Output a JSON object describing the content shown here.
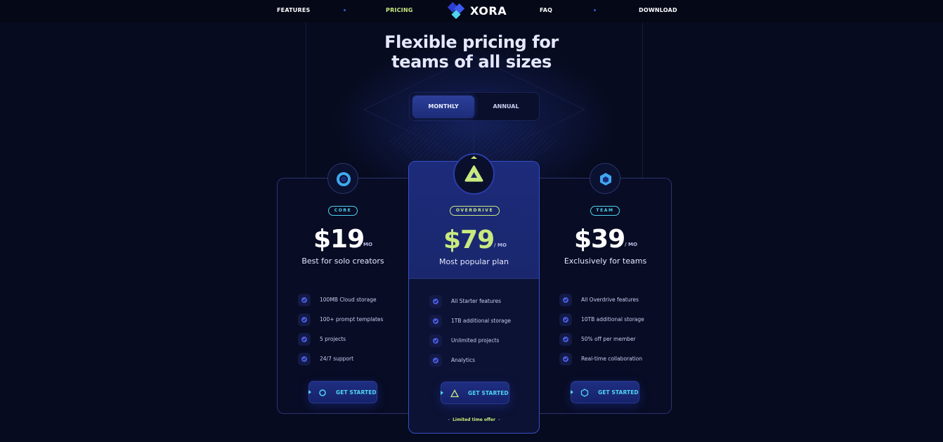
{
  "nav": {
    "features": "FEATURES",
    "pricing": "PRICING",
    "brand": "XORA",
    "faq": "FAQ",
    "download": "DOWNLOAD"
  },
  "heading": {
    "line1": "Flexible pricing for",
    "line2": "teams of all sizes"
  },
  "billing_toggle": {
    "monthly": "MONTHLY",
    "annual": "ANNUAL",
    "selected": "MONTHLY"
  },
  "plans": [
    {
      "badge": "CORE",
      "price": "$19",
      "period": "/ MO",
      "description": "Best for solo creators",
      "features": [
        "100MB Cloud storage",
        "100+ prompt templates",
        "5 projects",
        "24/7 support"
      ],
      "cta": "GET STARTED",
      "icon": "circle-ring-icon"
    },
    {
      "badge": "OVERDRIVE",
      "price": "$79",
      "period": "/ MO",
      "description": "Most popular plan",
      "features": [
        "All Starter features",
        "1TB additional storage",
        "Unlimited projects",
        "Analytics"
      ],
      "cta": "GET STARTED",
      "offer": "Limited time offer",
      "icon": "triangle-icon"
    },
    {
      "badge": "TEAM",
      "price": "$39",
      "period": "/ MO",
      "description": "Exclusively for teams",
      "features": [
        "All Overdrive features",
        "10TB additional storage",
        "50% off per member",
        "Real-time collaboration"
      ],
      "cta": "GET STARTED",
      "icon": "hexagon-icon"
    }
  ],
  "colors": {
    "background": "#070b1f",
    "accent_lime": "#c8ea80",
    "accent_cyan": "#4fd4f0",
    "accent_blue": "#3650c8"
  }
}
